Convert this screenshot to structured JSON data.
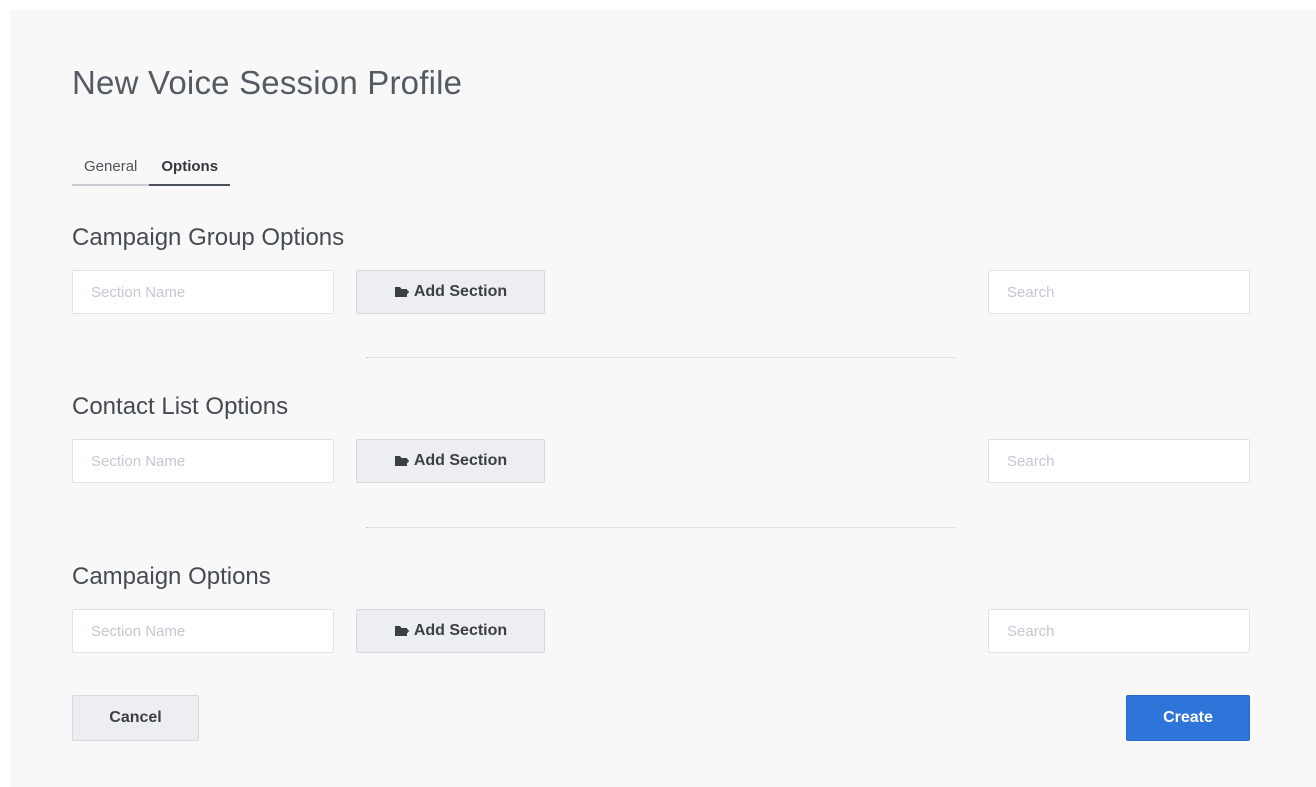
{
  "page": {
    "title": "New Voice Session Profile"
  },
  "tabs": [
    {
      "label": "General",
      "active": false
    },
    {
      "label": "Options",
      "active": true
    }
  ],
  "sections": [
    {
      "title": "Campaign Group Options",
      "section_name_placeholder": "Section Name",
      "add_label": "Add Section",
      "search_placeholder": "Search"
    },
    {
      "title": "Contact List Options",
      "section_name_placeholder": "Section Name",
      "add_label": "Add Section",
      "search_placeholder": "Search"
    },
    {
      "title": "Campaign Options",
      "section_name_placeholder": "Section Name",
      "add_label": "Add Section",
      "search_placeholder": "Search"
    }
  ],
  "icons": {
    "add_section": "folder-add-icon"
  },
  "footer": {
    "cancel_label": "Cancel",
    "create_label": "Create"
  },
  "colors": {
    "primary": "#2f74d8",
    "background": "#f8f8f8"
  }
}
